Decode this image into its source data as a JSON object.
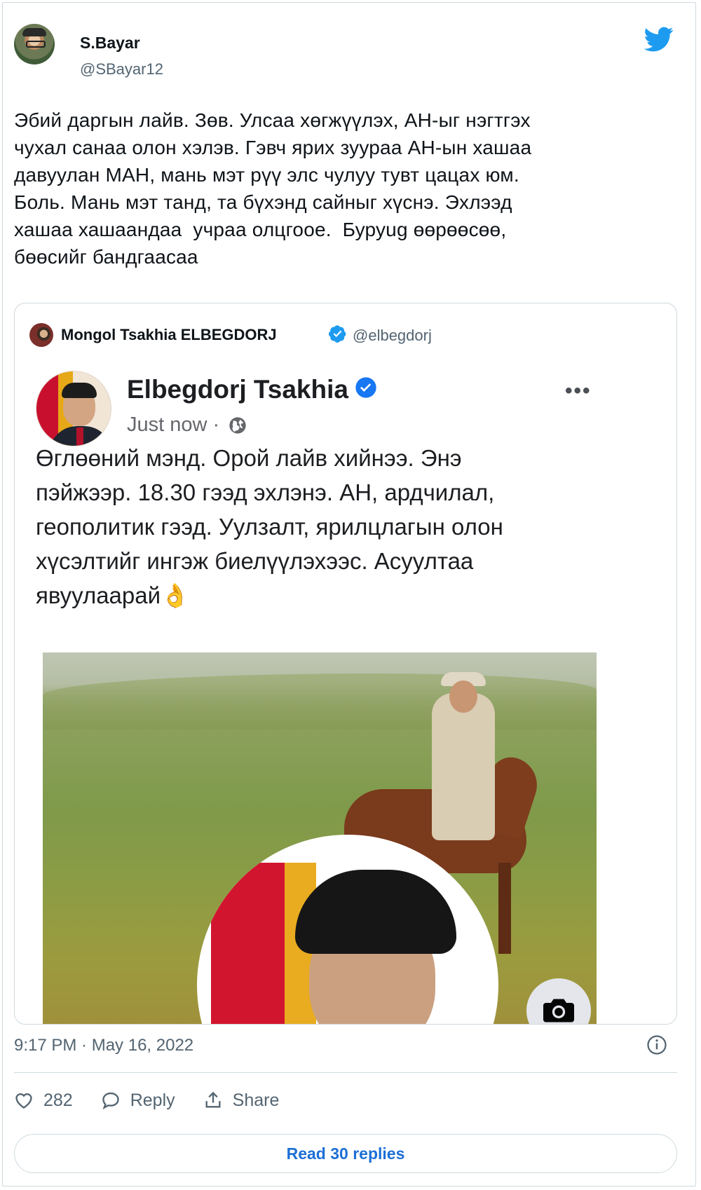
{
  "tweet": {
    "author_name": "S.Bayar",
    "author_handle": "@SBayar12",
    "text": "Эбий даргын лайв. Зөв. Улсаа хөгжүүлэх, АН-ыг нэгтгэх\nчухал санаа олон хэлэв. Гэвч ярих зуураа АН-ын хашаа\nдавуулан МАН, мань мэт рүү элс чулуу тувт цацах юм.\nБоль. Мань мэт танд, та бүхэнд сайныг хүснэ. Эхлээд\nхашаа хашаандаа  учраа олцгоое.  Буруug өөрөөсөө,\nбөөсийг бандгаасаа",
    "timestamp": "9:17 PM · May 16, 2022",
    "likes": "282",
    "reply_label": "Reply",
    "share_label": "Share",
    "read_replies_label": "Read 30 replies"
  },
  "quoted": {
    "author_name": "Mongol Tsakhia ELBEGDORJ",
    "author_handle": "@elbegdorj",
    "fb_name": "Elbegdorj Tsakhia",
    "fb_time": "Just now ·",
    "fb_text": "Өглөөний мэнд. Орой лайв хийнээ. Энэ\nпэйжээр. 18.30 гээд эхлэнэ. АН, ардчилал,\nгеополитик гээд. Уулзалт, ярилцлагын олон\nхүсэлтийг ингэж биелүүлэхээс. Асуултаа\nявуулаарай",
    "ok_emoji": "👌"
  },
  "colors": {
    "twitter_blue": "#1d9bf0",
    "link_blue": "#1d6fd6",
    "fb_verified": "#1877f2",
    "muted": "#536471"
  },
  "icons": [
    "twitter-bird-icon",
    "verified-icon",
    "globe-icon",
    "more-icon",
    "camera-icon",
    "info-icon",
    "heart-icon",
    "reply-icon",
    "share-icon"
  ]
}
